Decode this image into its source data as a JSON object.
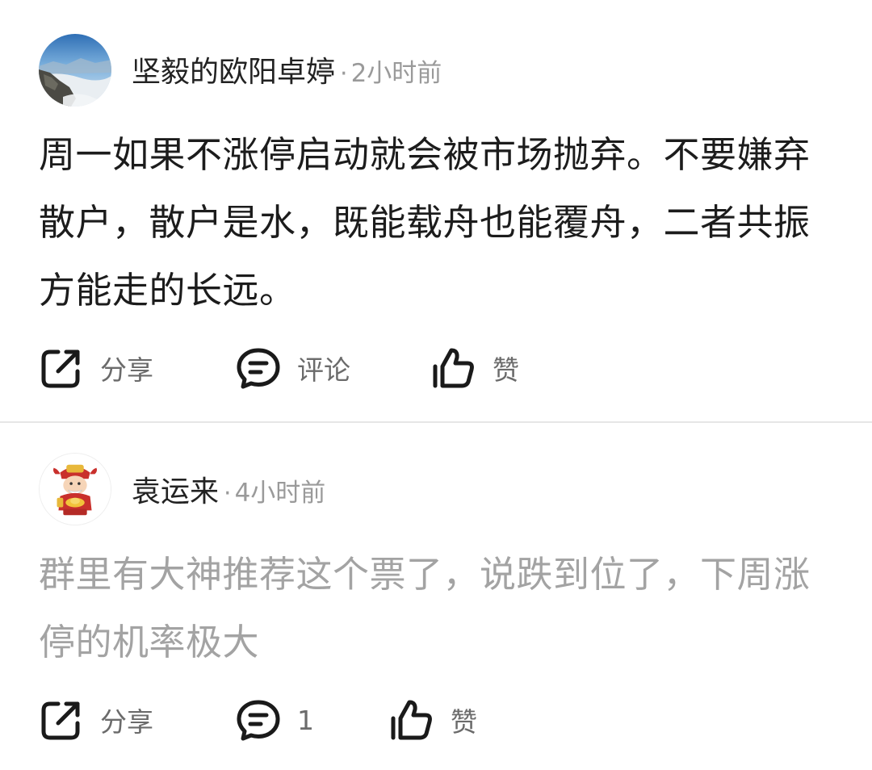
{
  "posts": [
    {
      "username": "坚毅的欧阳卓婷",
      "separator": "·",
      "time": "2小时前",
      "avatar_icon": "mountain-landscape-avatar",
      "content": "周一如果不涨停启动就会被市场抛弃。不要嫌弃散户，散户是水，既能载舟也能覆舟，二者共振方能走的长远。",
      "actions": {
        "share_label": "分享",
        "comment_label": "评论",
        "like_label": "赞"
      }
    },
    {
      "username": "袁运来",
      "separator": "·",
      "time": "4小时前",
      "avatar_icon": "god-of-wealth-avatar",
      "content": "群里有大神推荐这个票了，说跌到位了，下周涨停的机率极大",
      "actions": {
        "share_label": "分享",
        "comment_label": "1",
        "like_label": "赞"
      }
    }
  ],
  "colors": {
    "content_primary": "#1c1c1c",
    "content_muted": "#a3a3a3",
    "meta": "#9a9a9a",
    "action_label": "#6b6b6b",
    "icon": "#1a1a1a",
    "divider": "#e6e6e6"
  }
}
